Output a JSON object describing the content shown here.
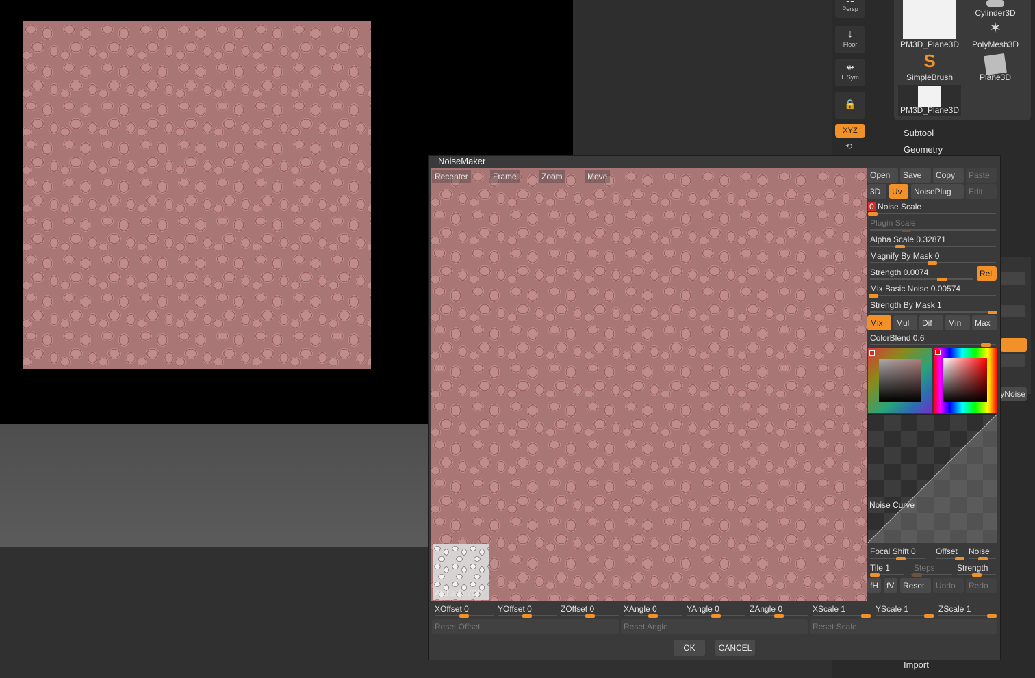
{
  "shelf": {
    "persp": "Persp",
    "floor": "Floor",
    "lsym": "L.Sym",
    "xyz": "XYZ"
  },
  "tools": [
    {
      "label": "Cylinder3D"
    },
    {
      "label": "PM3D_Plane3D"
    },
    {
      "label": "PolyMesh3D"
    },
    {
      "label": "SimpleBrush"
    },
    {
      "label": "Plane3D"
    },
    {
      "label": "PM3D_Plane3D"
    }
  ],
  "menu": {
    "subtool": "Subtool",
    "geometry": "Geometry",
    "polynoise_partial": "lyNoise",
    "import": "Import"
  },
  "dialog": {
    "title": "NoiseMaker",
    "preview_buttons": [
      "Recenter",
      "Frame",
      "Zoom",
      "Move"
    ],
    "alpha_toggle": "Alpha On/Off",
    "top_buttons": [
      {
        "label": "Open",
        "enabled": true
      },
      {
        "label": "Save",
        "enabled": true
      },
      {
        "label": "Copy",
        "enabled": true
      },
      {
        "label": "Paste",
        "enabled": false
      }
    ],
    "mode_buttons": [
      {
        "label": "3D",
        "active": false
      },
      {
        "label": "Uv",
        "active": true
      },
      {
        "label": "NoisePlug",
        "active": false
      },
      {
        "label": "Edit",
        "active": false,
        "enabled": false
      }
    ],
    "noise_scale": {
      "value": "0",
      "label": "Noise Scale",
      "level": 0.0
    },
    "plugin_scale": {
      "label": "Plugin Scale",
      "level": 0.27
    },
    "alpha_scale": {
      "label": "Alpha Scale  0.32871",
      "level": 0.25
    },
    "magnify_by_mask": {
      "label": "Magnify By Mask 0",
      "level": 0.5
    },
    "strength": {
      "label": "Strength 0.0074",
      "level": 0.72,
      "rel": "Rel"
    },
    "mix_basic_noise": {
      "label": "Mix Basic Noise 0.00574",
      "level": 0.02
    },
    "strength_by_mask": {
      "label": "Strength By Mask 1",
      "level": 1.0
    },
    "blend_modes": [
      {
        "label": "Mix",
        "active": true
      },
      {
        "label": "Mul",
        "active": false
      },
      {
        "label": "Dif",
        "active": false
      },
      {
        "label": "Min",
        "active": false
      },
      {
        "label": "Max",
        "active": false
      }
    ],
    "color_blend": {
      "label": "ColorBlend 0.6",
      "level": 0.96
    },
    "noise_curve": "Noise Curve",
    "focal_shift": {
      "label": "Focal Shift 0",
      "level": 0.55
    },
    "offset": {
      "label": "Offset"
    },
    "noise": {
      "label": "Noise"
    },
    "tile": {
      "label": "Tile 1",
      "level": 0.0
    },
    "steps": {
      "label": "Steps"
    },
    "strength2": {
      "label": "Strength"
    },
    "bottom_tools": [
      {
        "label": "fH",
        "enabled": true
      },
      {
        "label": "fV",
        "enabled": true
      },
      {
        "label": "Reset",
        "enabled": true
      },
      {
        "label": "Undo",
        "enabled": false
      },
      {
        "label": "Redo",
        "enabled": false
      }
    ],
    "transform_sliders": [
      {
        "label": "XOffset 0",
        "level": 0.5
      },
      {
        "label": "YOffset 0",
        "level": 0.5
      },
      {
        "label": "ZOffset 0",
        "level": 0.5
      },
      {
        "label": "XAngle 0",
        "level": 0.5
      },
      {
        "label": "YAngle 0",
        "level": 0.5
      },
      {
        "label": "ZAngle 0",
        "level": 0.5
      },
      {
        "label": "XScale 1",
        "level": 0.95
      },
      {
        "label": "YScale 1",
        "level": 0.95
      },
      {
        "label": "ZScale 1",
        "level": 0.95
      }
    ],
    "reset_buttons": [
      "Reset Offset",
      "Reset Angle",
      "Reset Scale"
    ],
    "ok": "OK",
    "cancel": "CANCEL"
  },
  "colors": {
    "accent": "#f39129",
    "texture": "#a97676",
    "panel": "#3a3a3a"
  }
}
